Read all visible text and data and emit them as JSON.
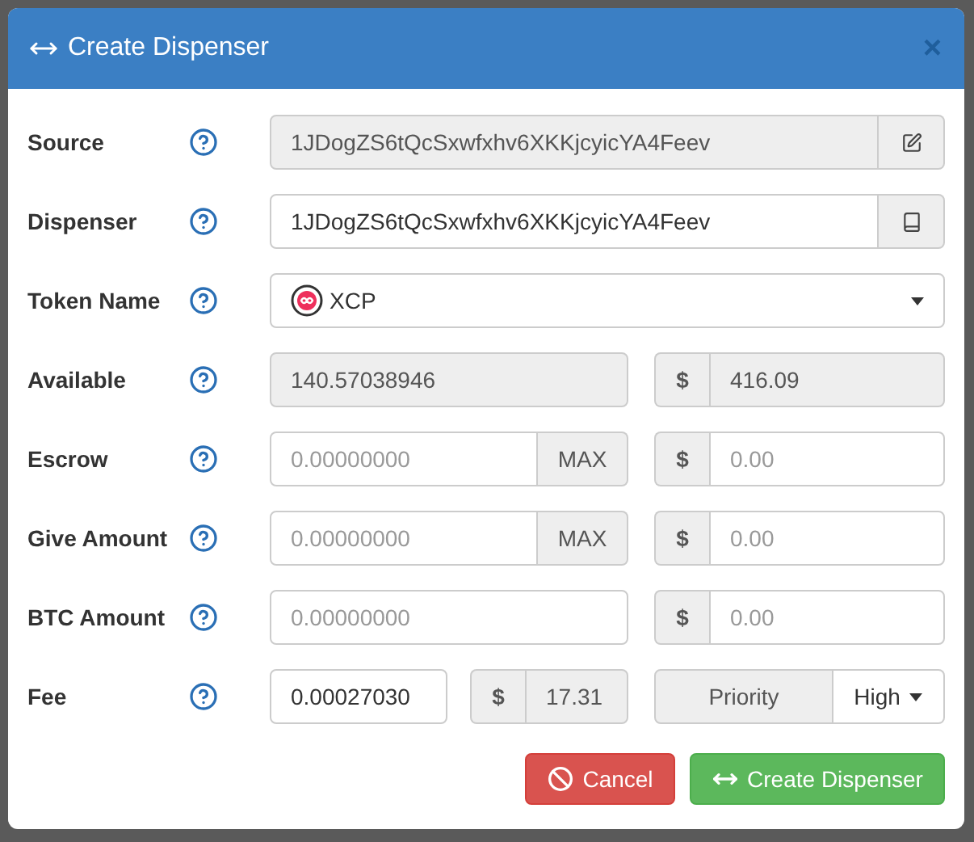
{
  "dialog": {
    "title": "Create Dispenser",
    "close": "×"
  },
  "rows": [
    {
      "kind": "editable",
      "label": "Source",
      "value": "1JDogZS6tQcSxwfxhv6XKKjcyicYA4Feev",
      "disabled": true
    },
    {
      "kind": "lookup",
      "label": "Dispenser",
      "value": "1JDogZS6tQcSxwfxhv6XKKjcyicYA4Feev",
      "disabled": false
    },
    {
      "kind": "select",
      "label": "Token Name",
      "value": "XCP"
    },
    {
      "kind": "amount",
      "label": "Available",
      "left": {
        "value": "140.57038946",
        "disabled": true
      },
      "right": {
        "prefix": "$",
        "value": "416.09",
        "disabled": true
      }
    },
    {
      "kind": "amount",
      "label": "Escrow",
      "left": {
        "placeholder": "0.00000000",
        "disabled": false,
        "addon": "MAX"
      },
      "right": {
        "prefix": "$",
        "placeholder": "0.00",
        "disabled": false
      }
    },
    {
      "kind": "amount",
      "label": "Give Amount",
      "left": {
        "placeholder": "0.00000000",
        "disabled": false,
        "addon": "MAX"
      },
      "right": {
        "prefix": "$",
        "placeholder": "0.00",
        "disabled": false
      }
    },
    {
      "kind": "amount",
      "label": "BTC Amount",
      "left": {
        "placeholder": "0.00000000",
        "disabled": false
      },
      "right": {
        "prefix": "$",
        "placeholder": "0.00",
        "disabled": false
      }
    },
    {
      "kind": "fee",
      "label": "Fee",
      "value": "0.00027030",
      "usd": {
        "prefix": "$",
        "value": "17.31"
      },
      "priority": {
        "label": "Priority",
        "value": "High"
      }
    }
  ],
  "buttons": [
    {
      "kind": "cancel",
      "label": "Cancel"
    },
    {
      "kind": "confirm",
      "label": "Create Dispenser"
    }
  ]
}
